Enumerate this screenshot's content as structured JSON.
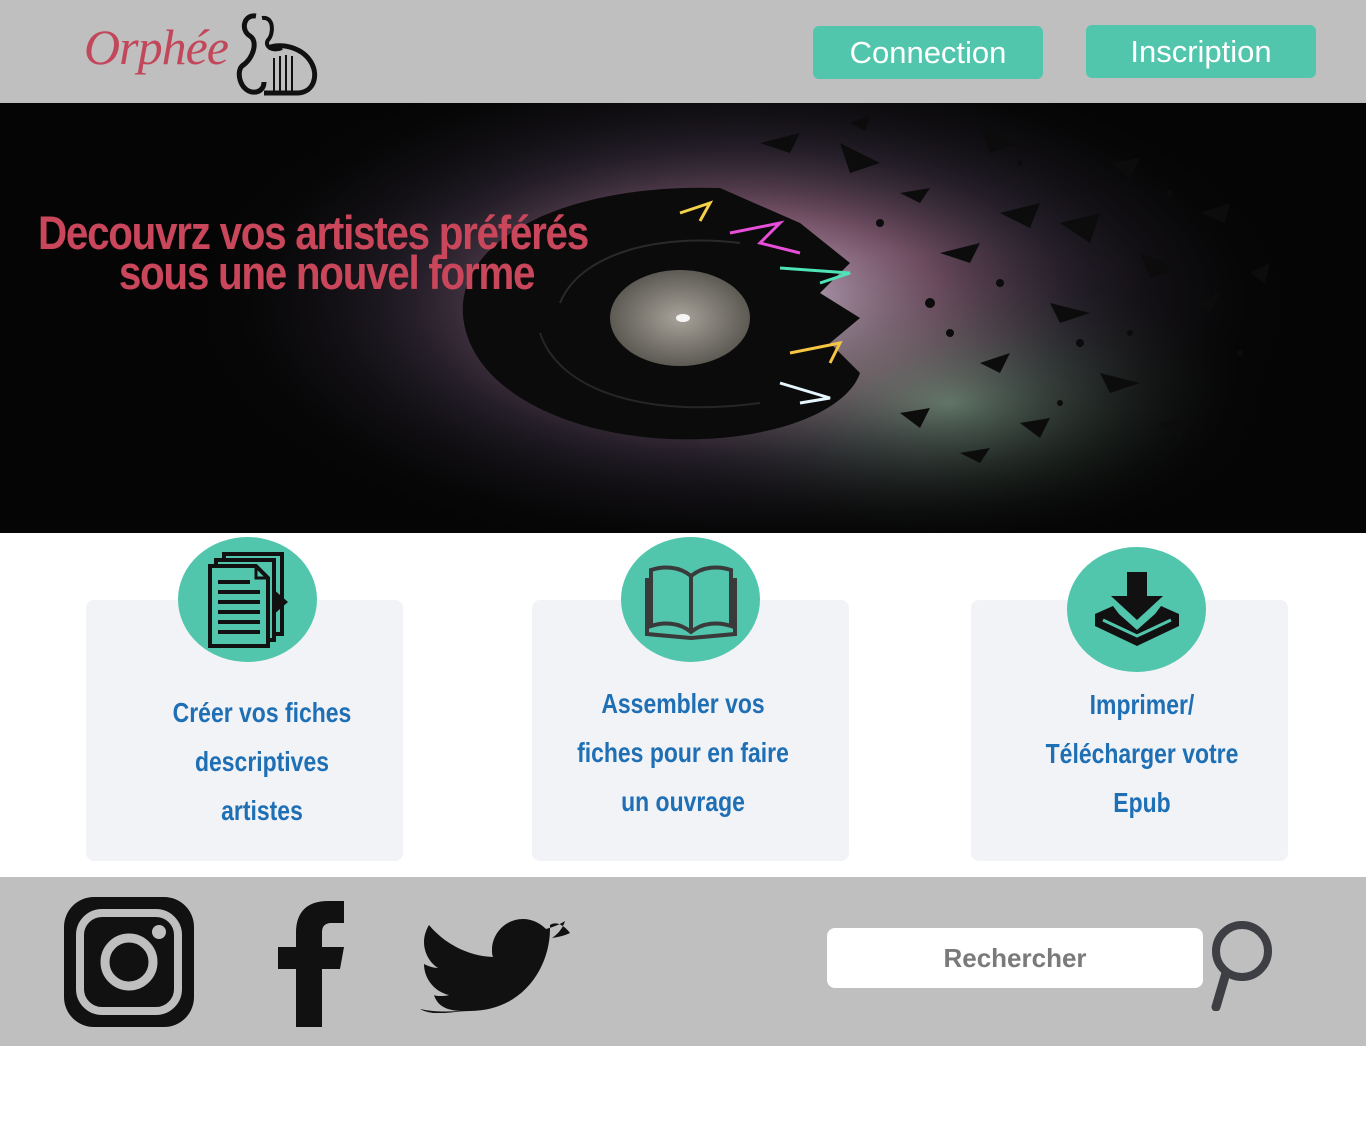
{
  "header": {
    "logo_text": "Orphée",
    "connect_label": "Connection",
    "register_label": "Inscription"
  },
  "hero": {
    "title_line1": "Decouvrz vos artistes préférés",
    "title_line2": "sous une nouvel forme"
  },
  "features": [
    {
      "icon": "documents-icon",
      "line1": "Créer vos fiches",
      "line2": "descriptives",
      "line3": "artistes"
    },
    {
      "icon": "open-book-icon",
      "line1": "Assembler vos",
      "line2": "fiches pour en faire",
      "line3": "un ouvrage"
    },
    {
      "icon": "download-tray-icon",
      "line1": "Imprimer/",
      "line2": "Télécharger votre",
      "line3": "Epub"
    }
  ],
  "footer": {
    "social": [
      "instagram-icon",
      "facebook-icon",
      "twitter-icon"
    ],
    "search_placeholder": "Rechercher"
  },
  "colors": {
    "accent": "#52c6ad",
    "brand": "#c9465b",
    "feature_text": "#1f6fb5",
    "bar_bg": "#bfbfbf"
  }
}
